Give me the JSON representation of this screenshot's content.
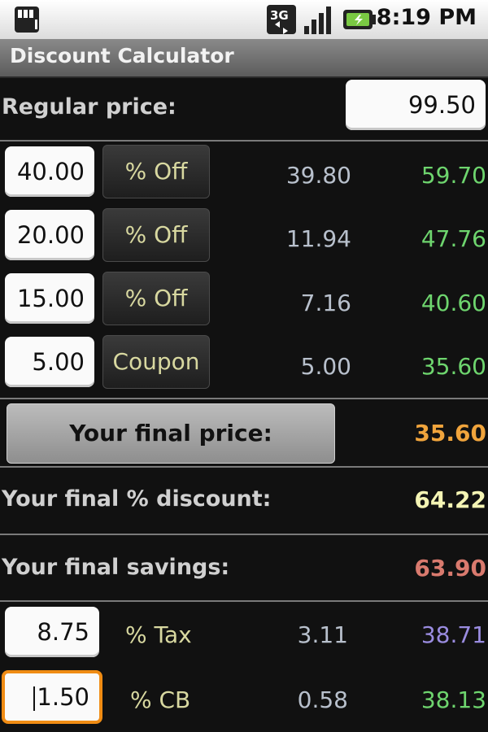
{
  "status": {
    "network": "3G",
    "time": "8:19 PM"
  },
  "title": "Discount Calculator",
  "regular": {
    "label": "Regular price:",
    "value": "99.50"
  },
  "discounts": [
    {
      "input": "40.00",
      "button": "% Off",
      "amount": "39.80",
      "result": "59.70"
    },
    {
      "input": "20.00",
      "button": "% Off",
      "amount": "11.94",
      "result": "47.76"
    },
    {
      "input": "15.00",
      "button": "% Off",
      "amount": "7.16",
      "result": "40.60"
    },
    {
      "input": "5.00",
      "button": "Coupon",
      "amount": "5.00",
      "result": "35.60"
    }
  ],
  "final": {
    "button": "Your final price:",
    "price": "35.60",
    "discount_label": "Your final % discount:",
    "discount": "64.22",
    "savings_label": "Your final savings:",
    "savings": "63.90"
  },
  "tax": {
    "input": "8.75",
    "label": "% Tax",
    "amount": "3.11",
    "total": "38.71"
  },
  "cb": {
    "input": "1.50",
    "label": "% CB",
    "amount": "0.58",
    "total": "38.13"
  },
  "colors": {
    "green": "#6ed56e",
    "orange": "#f0a43c",
    "yellow": "#f4f4b4",
    "red": "#d97a6e",
    "purple": "#9a8ce0",
    "focus": "#f08c14"
  }
}
